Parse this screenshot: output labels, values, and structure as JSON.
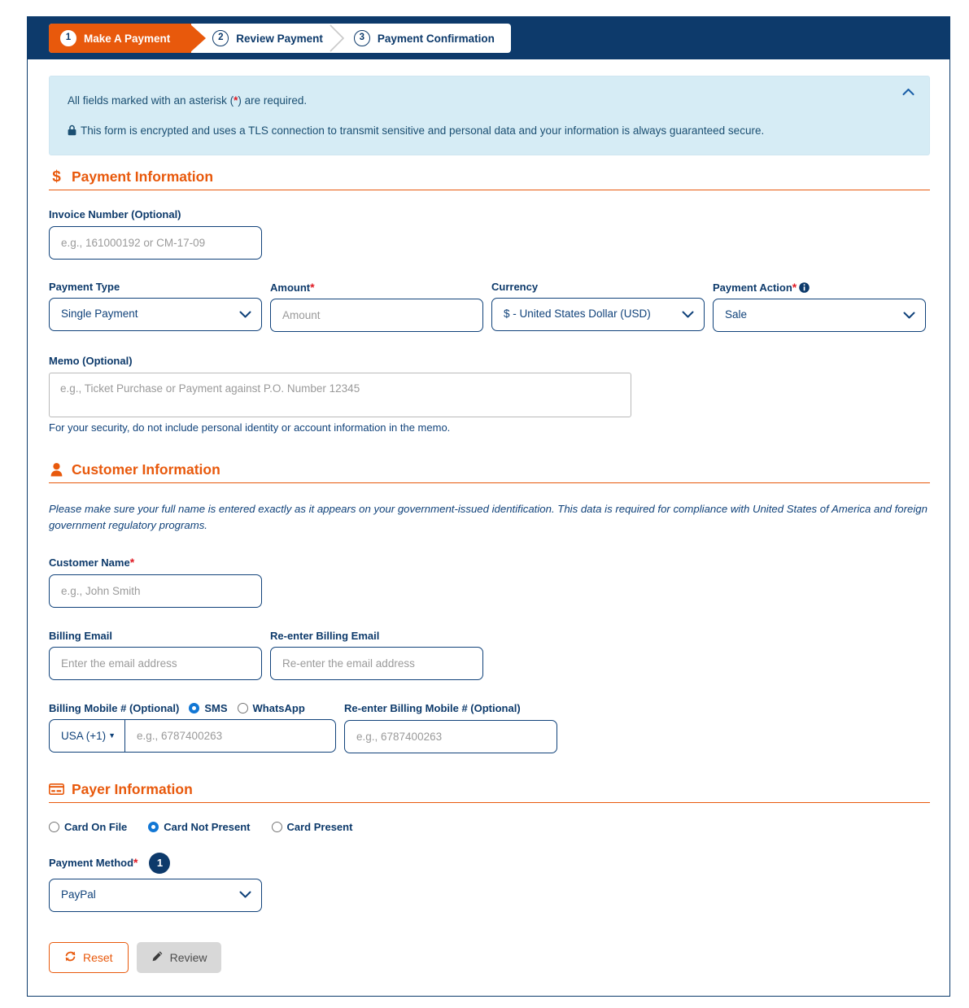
{
  "stepper": {
    "steps": [
      {
        "num": "1",
        "label": "Make A Payment",
        "state": "active"
      },
      {
        "num": "2",
        "label": "Review Payment",
        "state": "inactive"
      },
      {
        "num": "3",
        "label": "Payment Confirmation",
        "state": "inactive"
      }
    ]
  },
  "banner": {
    "required_text_before": "All fields marked with an asterisk (",
    "required_asterisk": "*",
    "required_text_after": ") are required.",
    "secure_text": "This form is encrypted and uses a TLS connection to transmit sensitive and personal data and your information is always guaranteed secure.",
    "collapse_icon": "chevron-up-icon"
  },
  "payment_information": {
    "heading": "Payment Information",
    "heading_icon": "dollar-icon",
    "invoice_number": {
      "label": "Invoice Number (Optional)",
      "placeholder": "e.g., 161000192 or CM-17-09",
      "value": ""
    },
    "payment_type": {
      "label": "Payment Type",
      "value": "Single Payment",
      "options": [
        "Single Payment"
      ]
    },
    "amount": {
      "label": "Amount",
      "required": "*",
      "placeholder": "Amount",
      "value": ""
    },
    "currency": {
      "label": "Currency",
      "value": "$ - United States Dollar (USD)",
      "options": [
        "$ - United States Dollar (USD)"
      ]
    },
    "payment_action": {
      "label": "Payment Action",
      "required": "*",
      "info_icon": "info-circle-icon",
      "value": "Sale",
      "options": [
        "Sale"
      ]
    },
    "memo": {
      "label": "Memo (Optional)",
      "placeholder": "e.g., Ticket Purchase or Payment against P.O. Number 12345",
      "value": "",
      "note": "For your security, do not include personal identity or account information in the memo."
    }
  },
  "customer_information": {
    "heading": "Customer Information",
    "heading_icon": "user-icon",
    "compliance_note": "Please make sure your full name is entered exactly as it appears on your government-issued identification. This data is required for compliance with United States of America and foreign government regulatory programs.",
    "customer_name": {
      "label": "Customer Name",
      "required": "*",
      "placeholder": "e.g., John Smith",
      "value": ""
    },
    "billing_email": {
      "label": "Billing Email",
      "placeholder": "Enter the email address",
      "value": ""
    },
    "reenter_billing_email": {
      "label": "Re-enter Billing Email",
      "placeholder": "Re-enter the email address",
      "value": ""
    },
    "billing_mobile": {
      "label": "Billing Mobile # (Optional)",
      "channels": [
        {
          "label": "SMS",
          "selected": true
        },
        {
          "label": "WhatsApp",
          "selected": false
        }
      ],
      "country_code": "USA (+1)",
      "placeholder": "e.g., 6787400263",
      "value": ""
    },
    "reenter_billing_mobile": {
      "label": "Re-enter Billing Mobile # (Optional)",
      "placeholder": "e.g., 6787400263",
      "value": ""
    }
  },
  "payer_information": {
    "heading": "Payer Information",
    "heading_icon": "credit-card-icon",
    "card_presence_options": [
      {
        "label": "Card On File",
        "selected": false
      },
      {
        "label": "Card Not Present",
        "selected": true
      },
      {
        "label": "Card Present",
        "selected": false
      }
    ],
    "payment_method": {
      "label": "Payment Method",
      "required": "*",
      "badge": "1",
      "value": "PayPal",
      "options": [
        "PayPal"
      ]
    }
  },
  "actions": {
    "reset_label": "Reset",
    "reset_icon": "refresh-icon",
    "review_label": "Review",
    "review_icon": "pencil-icon"
  },
  "colors": {
    "navy": "#0d3a6b",
    "orange": "#e8590c",
    "banner_bg": "#d6ecf5",
    "required_red": "#e01b24",
    "radio_blue": "#1277d4"
  }
}
